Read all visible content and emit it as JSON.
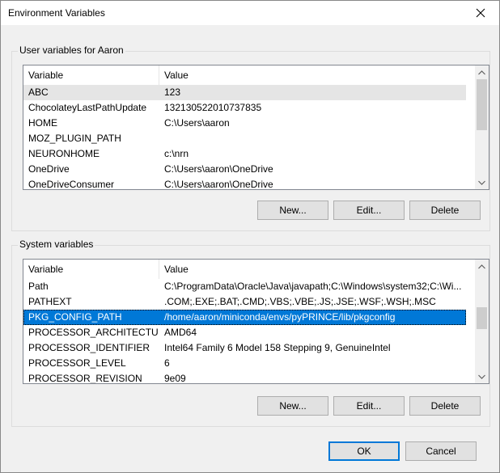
{
  "window": {
    "title": "Environment Variables"
  },
  "user_group": {
    "label": "User variables for Aaron",
    "columns": [
      "Variable",
      "Value"
    ],
    "rows": [
      {
        "name": "ABC",
        "value": "123"
      },
      {
        "name": "ChocolateyLastPathUpdate",
        "value": "132130522010737835"
      },
      {
        "name": "HOME",
        "value": "C:\\Users\\aaron"
      },
      {
        "name": "MOZ_PLUGIN_PATH",
        "value": ""
      },
      {
        "name": "NEURONHOME",
        "value": "c:\\nrn"
      },
      {
        "name": "OneDrive",
        "value": "C:\\Users\\aaron\\OneDrive"
      },
      {
        "name": "OneDriveConsumer",
        "value": "C:\\Users\\aaron\\OneDrive"
      }
    ],
    "buttons": {
      "new": "New...",
      "edit": "Edit...",
      "delete": "Delete"
    }
  },
  "system_group": {
    "label": "System variables",
    "columns": [
      "Variable",
      "Value"
    ],
    "rows": [
      {
        "name": "Path",
        "value": "C:\\ProgramData\\Oracle\\Java\\javapath;C:\\Windows\\system32;C:\\Wi..."
      },
      {
        "name": "PATHEXT",
        "value": ".COM;.EXE;.BAT;.CMD;.VBS;.VBE;.JS;.JSE;.WSF;.WSH;.MSC"
      },
      {
        "name": "PKG_CONFIG_PATH",
        "value": "/home/aaron/miniconda/envs/pyPRINCE/lib/pkgconfig"
      },
      {
        "name": "PROCESSOR_ARCHITECTURE",
        "value": "AMD64"
      },
      {
        "name": "PROCESSOR_IDENTIFIER",
        "value": "Intel64 Family 6 Model 158 Stepping 9, GenuineIntel"
      },
      {
        "name": "PROCESSOR_LEVEL",
        "value": "6"
      },
      {
        "name": "PROCESSOR_REVISION",
        "value": "9e09"
      }
    ],
    "buttons": {
      "new": "New...",
      "edit": "Edit...",
      "delete": "Delete"
    }
  },
  "footer": {
    "ok": "OK",
    "cancel": "Cancel"
  },
  "colors": {
    "selection": "#0078d7",
    "hover": "#e5e5e5",
    "dialog_bg": "#f0f0f0"
  },
  "icons": {
    "close": "close-icon",
    "scroll_up": "chevron-up-icon",
    "scroll_down": "chevron-down-icon"
  }
}
